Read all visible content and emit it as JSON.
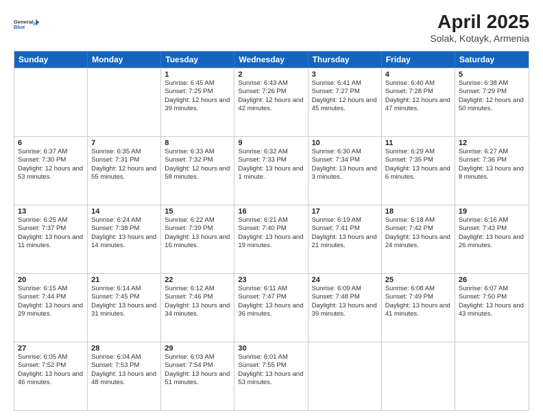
{
  "header": {
    "logo_line1": "General",
    "logo_line2": "Blue",
    "title": "April 2025",
    "subtitle": "Solak, Kotayk, Armenia"
  },
  "days_of_week": [
    "Sunday",
    "Monday",
    "Tuesday",
    "Wednesday",
    "Thursday",
    "Friday",
    "Saturday"
  ],
  "weeks": [
    [
      {
        "day": "",
        "sunrise": "",
        "sunset": "",
        "daylight": ""
      },
      {
        "day": "",
        "sunrise": "",
        "sunset": "",
        "daylight": ""
      },
      {
        "day": "1",
        "sunrise": "Sunrise: 6:45 AM",
        "sunset": "Sunset: 7:25 PM",
        "daylight": "Daylight: 12 hours and 39 minutes."
      },
      {
        "day": "2",
        "sunrise": "Sunrise: 6:43 AM",
        "sunset": "Sunset: 7:26 PM",
        "daylight": "Daylight: 12 hours and 42 minutes."
      },
      {
        "day": "3",
        "sunrise": "Sunrise: 6:41 AM",
        "sunset": "Sunset: 7:27 PM",
        "daylight": "Daylight: 12 hours and 45 minutes."
      },
      {
        "day": "4",
        "sunrise": "Sunrise: 6:40 AM",
        "sunset": "Sunset: 7:28 PM",
        "daylight": "Daylight: 12 hours and 47 minutes."
      },
      {
        "day": "5",
        "sunrise": "Sunrise: 6:38 AM",
        "sunset": "Sunset: 7:29 PM",
        "daylight": "Daylight: 12 hours and 50 minutes."
      }
    ],
    [
      {
        "day": "6",
        "sunrise": "Sunrise: 6:37 AM",
        "sunset": "Sunset: 7:30 PM",
        "daylight": "Daylight: 12 hours and 53 minutes."
      },
      {
        "day": "7",
        "sunrise": "Sunrise: 6:35 AM",
        "sunset": "Sunset: 7:31 PM",
        "daylight": "Daylight: 12 hours and 55 minutes."
      },
      {
        "day": "8",
        "sunrise": "Sunrise: 6:33 AM",
        "sunset": "Sunset: 7:32 PM",
        "daylight": "Daylight: 12 hours and 58 minutes."
      },
      {
        "day": "9",
        "sunrise": "Sunrise: 6:32 AM",
        "sunset": "Sunset: 7:33 PM",
        "daylight": "Daylight: 13 hours and 1 minute."
      },
      {
        "day": "10",
        "sunrise": "Sunrise: 6:30 AM",
        "sunset": "Sunset: 7:34 PM",
        "daylight": "Daylight: 13 hours and 3 minutes."
      },
      {
        "day": "11",
        "sunrise": "Sunrise: 6:29 AM",
        "sunset": "Sunset: 7:35 PM",
        "daylight": "Daylight: 13 hours and 6 minutes."
      },
      {
        "day": "12",
        "sunrise": "Sunrise: 6:27 AM",
        "sunset": "Sunset: 7:36 PM",
        "daylight": "Daylight: 13 hours and 8 minutes."
      }
    ],
    [
      {
        "day": "13",
        "sunrise": "Sunrise: 6:25 AM",
        "sunset": "Sunset: 7:37 PM",
        "daylight": "Daylight: 13 hours and 11 minutes."
      },
      {
        "day": "14",
        "sunrise": "Sunrise: 6:24 AM",
        "sunset": "Sunset: 7:38 PM",
        "daylight": "Daylight: 13 hours and 14 minutes."
      },
      {
        "day": "15",
        "sunrise": "Sunrise: 6:22 AM",
        "sunset": "Sunset: 7:39 PM",
        "daylight": "Daylight: 13 hours and 16 minutes."
      },
      {
        "day": "16",
        "sunrise": "Sunrise: 6:21 AM",
        "sunset": "Sunset: 7:40 PM",
        "daylight": "Daylight: 13 hours and 19 minutes."
      },
      {
        "day": "17",
        "sunrise": "Sunrise: 6:19 AM",
        "sunset": "Sunset: 7:41 PM",
        "daylight": "Daylight: 13 hours and 21 minutes."
      },
      {
        "day": "18",
        "sunrise": "Sunrise: 6:18 AM",
        "sunset": "Sunset: 7:42 PM",
        "daylight": "Daylight: 13 hours and 24 minutes."
      },
      {
        "day": "19",
        "sunrise": "Sunrise: 6:16 AM",
        "sunset": "Sunset: 7:43 PM",
        "daylight": "Daylight: 13 hours and 26 minutes."
      }
    ],
    [
      {
        "day": "20",
        "sunrise": "Sunrise: 6:15 AM",
        "sunset": "Sunset: 7:44 PM",
        "daylight": "Daylight: 13 hours and 29 minutes."
      },
      {
        "day": "21",
        "sunrise": "Sunrise: 6:14 AM",
        "sunset": "Sunset: 7:45 PM",
        "daylight": "Daylight: 13 hours and 31 minutes."
      },
      {
        "day": "22",
        "sunrise": "Sunrise: 6:12 AM",
        "sunset": "Sunset: 7:46 PM",
        "daylight": "Daylight: 13 hours and 34 minutes."
      },
      {
        "day": "23",
        "sunrise": "Sunrise: 6:11 AM",
        "sunset": "Sunset: 7:47 PM",
        "daylight": "Daylight: 13 hours and 36 minutes."
      },
      {
        "day": "24",
        "sunrise": "Sunrise: 6:09 AM",
        "sunset": "Sunset: 7:48 PM",
        "daylight": "Daylight: 13 hours and 39 minutes."
      },
      {
        "day": "25",
        "sunrise": "Sunrise: 6:08 AM",
        "sunset": "Sunset: 7:49 PM",
        "daylight": "Daylight: 13 hours and 41 minutes."
      },
      {
        "day": "26",
        "sunrise": "Sunrise: 6:07 AM",
        "sunset": "Sunset: 7:50 PM",
        "daylight": "Daylight: 13 hours and 43 minutes."
      }
    ],
    [
      {
        "day": "27",
        "sunrise": "Sunrise: 6:05 AM",
        "sunset": "Sunset: 7:52 PM",
        "daylight": "Daylight: 13 hours and 46 minutes."
      },
      {
        "day": "28",
        "sunrise": "Sunrise: 6:04 AM",
        "sunset": "Sunset: 7:53 PM",
        "daylight": "Daylight: 13 hours and 48 minutes."
      },
      {
        "day": "29",
        "sunrise": "Sunrise: 6:03 AM",
        "sunset": "Sunset: 7:54 PM",
        "daylight": "Daylight: 13 hours and 51 minutes."
      },
      {
        "day": "30",
        "sunrise": "Sunrise: 6:01 AM",
        "sunset": "Sunset: 7:55 PM",
        "daylight": "Daylight: 13 hours and 53 minutes."
      },
      {
        "day": "",
        "sunrise": "",
        "sunset": "",
        "daylight": ""
      },
      {
        "day": "",
        "sunrise": "",
        "sunset": "",
        "daylight": ""
      },
      {
        "day": "",
        "sunrise": "",
        "sunset": "",
        "daylight": ""
      }
    ]
  ]
}
